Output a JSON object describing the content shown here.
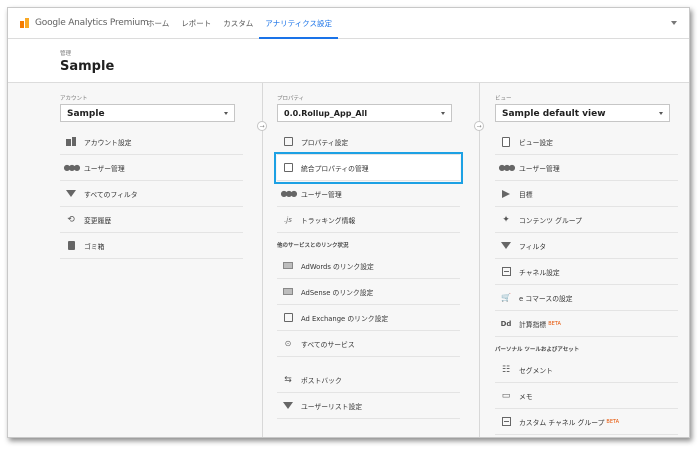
{
  "app": {
    "logo_text": "Google Analytics Premium",
    "nav": [
      "ホーム",
      "レポート",
      "カスタム",
      "アナリティクス設定"
    ],
    "active_nav_index": 3
  },
  "admin": {
    "label": "管理",
    "title": "Sample"
  },
  "account": {
    "label": "アカウント",
    "selected": "Sample",
    "items": [
      {
        "label": "アカウント設定",
        "icon": "building-icon"
      },
      {
        "label": "ユーザー管理",
        "icon": "users-icon"
      },
      {
        "label": "すべてのフィルタ",
        "icon": "filter-icon"
      },
      {
        "label": "変更履歴",
        "icon": "history-icon"
      },
      {
        "label": "ゴミ箱",
        "icon": "trash-icon"
      }
    ]
  },
  "property": {
    "label": "プロパティ",
    "selected": "0.0.Rollup_App_All",
    "items": [
      {
        "label": "プロパティ設定",
        "icon": "property-settings-icon"
      },
      {
        "label": "統合プロパティの管理",
        "icon": "rollup-management-icon",
        "highlighted": true
      },
      {
        "label": "ユーザー管理",
        "icon": "users-icon"
      },
      {
        "label": "トラッキング情報",
        "icon": "js-icon"
      }
    ],
    "links_section": "他のサービスとのリンク状況",
    "link_items": [
      {
        "label": "AdWords のリンク設定",
        "icon": "adwords-icon"
      },
      {
        "label": "AdSense のリンク設定",
        "icon": "adsense-icon"
      },
      {
        "label": "Ad Exchange のリンク設定",
        "icon": "adexchange-icon"
      },
      {
        "label": "すべてのサービス",
        "icon": "all-services-icon"
      }
    ],
    "extra_items": [
      {
        "label": "ポストバック",
        "icon": "postback-icon"
      },
      {
        "label": "ユーザーリスト設定",
        "icon": "user-list-icon"
      }
    ]
  },
  "view": {
    "label": "ビュー",
    "selected": "Sample default view",
    "items": [
      {
        "label": "ビュー設定",
        "icon": "view-settings-icon"
      },
      {
        "label": "ユーザー管理",
        "icon": "users-icon"
      },
      {
        "label": "目標",
        "icon": "goal-flag-icon"
      },
      {
        "label": "コンテンツ グループ",
        "icon": "content-group-icon"
      },
      {
        "label": "フィルタ",
        "icon": "filter-icon"
      },
      {
        "label": "チャネル設定",
        "icon": "channel-icon"
      },
      {
        "label": "e コマースの設定",
        "icon": "cart-icon"
      },
      {
        "label": "計算指標",
        "icon": "dd-icon",
        "badge": "BETA"
      }
    ],
    "personal_section": "パーソナル ツールおよびアセット",
    "personal_items": [
      {
        "label": "セグメント",
        "icon": "segment-icon"
      },
      {
        "label": "メモ",
        "icon": "memo-icon"
      },
      {
        "label": "カスタム チャネル グループ",
        "icon": "custom-channel-icon",
        "badge": "BETA"
      }
    ]
  }
}
